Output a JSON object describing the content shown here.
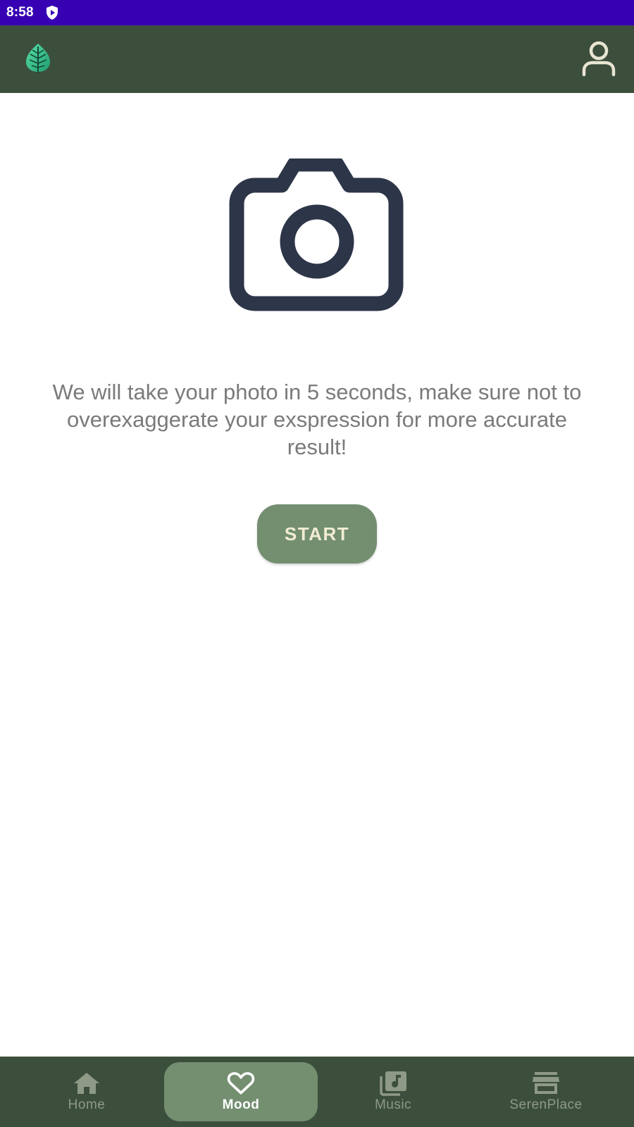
{
  "status_bar": {
    "time": "8:58",
    "icons": [
      "shield-play-icon"
    ]
  },
  "app_bar": {
    "logo": "leaf-logo",
    "profile_icon": "person-icon"
  },
  "main": {
    "camera_icon": "camera-icon",
    "instruction": "We will take your photo in 5 seconds, make sure not to overexaggerate your exspression for more accurate result!",
    "start_label": "START"
  },
  "bottom_nav": {
    "items": [
      {
        "label": "Home",
        "icon": "home-icon",
        "active": false
      },
      {
        "label": "Mood",
        "icon": "heart-icon",
        "active": true
      },
      {
        "label": "Music",
        "icon": "music-library-icon",
        "active": false
      },
      {
        "label": "SerenPlace",
        "icon": "store-icon",
        "active": false
      }
    ]
  },
  "colors": {
    "status_bar": "#3700b3",
    "app_bar": "#3c4f3c",
    "accent": "#738f70",
    "button_text": "#f1ecd2",
    "camera_stroke": "#2d3548",
    "instruction_text": "#7a7a7a",
    "nav_inactive": "#8e9a86"
  }
}
